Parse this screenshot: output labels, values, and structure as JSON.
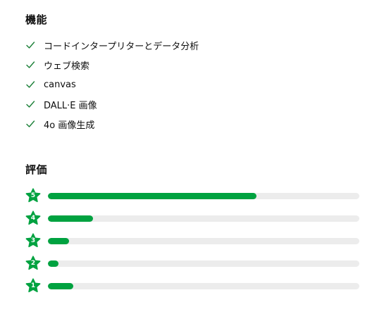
{
  "features": {
    "title": "機能",
    "items": [
      {
        "label": "コードインタープリターとデータ分析",
        "icon": "check-icon"
      },
      {
        "label": "ウェブ検索",
        "icon": "check-icon"
      },
      {
        "label": "canvas",
        "icon": "check-icon"
      },
      {
        "label": "DALL·E 画像",
        "icon": "check-icon"
      },
      {
        "label": "4o 画像生成",
        "icon": "check-icon"
      }
    ]
  },
  "ratings": {
    "title": "評価",
    "rows": [
      {
        "stars": "5",
        "fraction": 0.67,
        "icon": "star-icon"
      },
      {
        "stars": "4",
        "fraction": 0.145,
        "icon": "star-icon"
      },
      {
        "stars": "3",
        "fraction": 0.068,
        "icon": "star-icon"
      },
      {
        "stars": "2",
        "fraction": 0.034,
        "icon": "star-icon"
      },
      {
        "stars": "1",
        "fraction": 0.082,
        "icon": "star-icon"
      }
    ]
  },
  "colors": {
    "accent": "#00a240",
    "check": "#1a7f37",
    "track": "#ececec"
  }
}
